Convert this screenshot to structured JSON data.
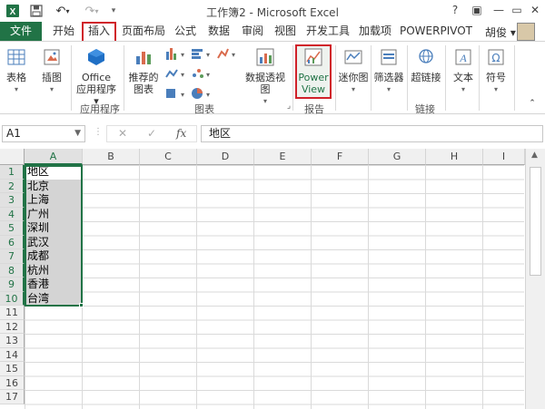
{
  "window": {
    "title": "工作簿2 - Microsoft Excel",
    "help": "?",
    "minimize": "—",
    "restore": "▭",
    "close": "✕"
  },
  "ribbon_tabs": {
    "file": "文件",
    "home": "开始",
    "insert": "插入",
    "page_layout": "页面布局",
    "formulas": "公式",
    "data": "数据",
    "review": "审阅",
    "view": "视图",
    "developer": "开发工具",
    "addins": "加载项",
    "powerpivot": "POWERPIVOT",
    "user": "胡俊 ▾"
  },
  "ribbon": {
    "tables": "表格",
    "illustrations": "插图",
    "office_apps_1": "Office",
    "office_apps_2": "应用程序 ▾",
    "recommended_1": "推荐的",
    "recommended_2": "图表",
    "pivotchart": "数据透视图",
    "powerview_1": "Power",
    "powerview_2": "View",
    "sparklines": "迷你图",
    "filters": "筛选器",
    "hyperlink": "超链接",
    "text": "文本",
    "symbols": "符号",
    "group_apps": "应用程序",
    "group_charts": "图表",
    "group_reports": "报告",
    "group_links": "链接"
  },
  "formula_bar": {
    "name_box": "A1",
    "cancel": "✕",
    "enter": "✓",
    "fx": "fx",
    "value": "地区"
  },
  "columns": [
    "A",
    "B",
    "C",
    "D",
    "E",
    "F",
    "G",
    "H",
    "I"
  ],
  "rows": [
    "1",
    "2",
    "3",
    "4",
    "5",
    "6",
    "7",
    "8",
    "9",
    "10",
    "11",
    "12",
    "13",
    "14",
    "15",
    "16",
    "17"
  ],
  "cells": {
    "a1": "地区",
    "a2": "北京",
    "a3": "上海",
    "a4": "广州",
    "a5": "深圳",
    "a6": "武汉",
    "a7": "成都",
    "a8": "杭州",
    "a9": "香港",
    "a10": "台湾"
  },
  "colors": {
    "excel_green": "#217346",
    "highlight_red": "#d0212a",
    "selection_fill": "#d4d4d4"
  }
}
